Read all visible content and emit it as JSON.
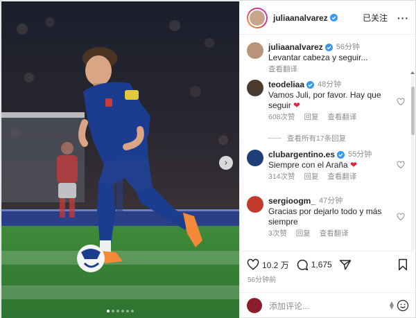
{
  "post": {
    "carousel_dots": 6,
    "active_dot": 0
  },
  "header": {
    "username": "juliaanalvarez",
    "follow_label": "已关注",
    "more_label": "···"
  },
  "comments": [
    {
      "username": "juliaanalvarez",
      "time": "56分钟",
      "text": "Levantar cabeza y seguir...",
      "meta": [
        "查看翻译"
      ]
    },
    {
      "username": "teodeliaa",
      "time": "48分钟",
      "text": "Vamos Juli, por favor. Hay que seguir",
      "emoji": "❤",
      "meta": [
        "608次赞",
        "回复",
        "查看翻译"
      ]
    },
    {
      "username": "clubargentino.es",
      "time": "55分钟",
      "text": "Siempre con el Araña",
      "emoji": "❤",
      "meta": [
        "314次赞",
        "回复",
        "查看翻译"
      ]
    },
    {
      "username": "sergioogm_",
      "time": "47分钟",
      "text": "Gracias por dejarlo todo y más siempre",
      "meta": [
        "3次赞",
        "回复",
        "查看翻译"
      ]
    }
  ],
  "view_replies": "查看所有17条回复",
  "actions": {
    "likes": "10.2 万",
    "comments": "1,675",
    "time_ago": "56分钟前"
  },
  "add_comment": {
    "placeholder": "添加评论..."
  },
  "colors": {
    "verified": "#3897f0",
    "heart": "#e0243b",
    "kit_blue": "#1c3d8f"
  }
}
